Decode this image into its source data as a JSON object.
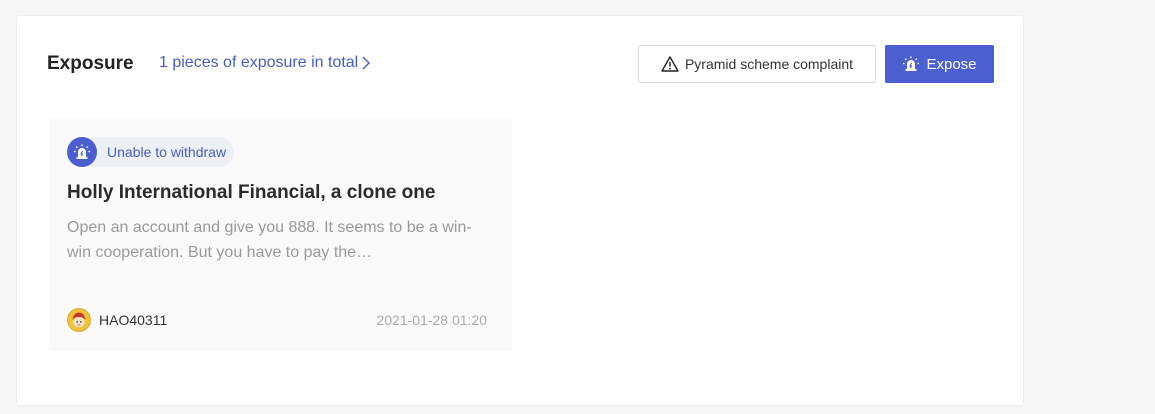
{
  "header": {
    "title": "Exposure",
    "total_link": "1 pieces of exposure in total"
  },
  "actions": {
    "complaint_label": "Pyramid scheme complaint",
    "expose_label": "Expose"
  },
  "colors": {
    "accent": "#4c5fd0",
    "link": "#4a5dc0",
    "tag_bg": "#eef0f7"
  },
  "exposures": [
    {
      "tag": "Unable to withdraw",
      "tag_icon": "siren-alarm-icon",
      "title": "Holly International Financial, a clone one",
      "description": "Open an account and give you 888. It seems to be a win-win cooperation. But you have to pay the…",
      "author": "HAO40311",
      "date": "2021-01-28 01:20"
    }
  ]
}
